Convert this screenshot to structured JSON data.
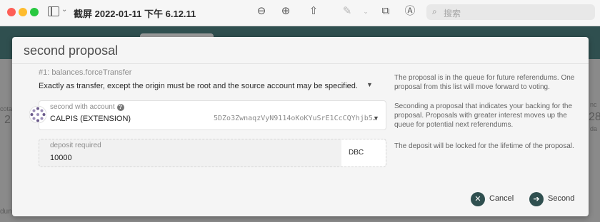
{
  "toolbar": {
    "window_title": "截屏 2022-01-11 下午 6.12.11",
    "search_placeholder": "搜索"
  },
  "background": {
    "left_fragment_1": "cota",
    "left_fragment_2": "2",
    "left_fragment_3": "dun",
    "right_fragment_1": "nc",
    "right_fragment_2": "28",
    "right_fragment_3": "da"
  },
  "modal": {
    "title": "second proposal",
    "call_label": "#1: balances.forceTransfer",
    "call_description": "Exactly as transfer, except the origin must be root and the source account may be specified.",
    "info_queue": "The proposal is in the queue for future referendums. One proposal from this list will move forward to voting.",
    "account": {
      "label": "second with account",
      "name": "CALPIS (EXTENSION)",
      "address": "5DZo3ZwnaqzVyN9114oKoKYuSrE1CcCQYhjb5…"
    },
    "info_seconding": "Seconding a proposal that indicates your backing for the proposal. Proposals with greater interest moves up the queue for potential next referendums.",
    "deposit": {
      "label": "deposit required",
      "value": "10000",
      "unit": "DBC"
    },
    "info_deposit": "The deposit will be locked for the lifetime of the proposal.",
    "cancel_label": "Cancel",
    "second_label": "Second"
  },
  "colors": {
    "header": "#2f4f4f",
    "button": "#2f4f4f"
  }
}
